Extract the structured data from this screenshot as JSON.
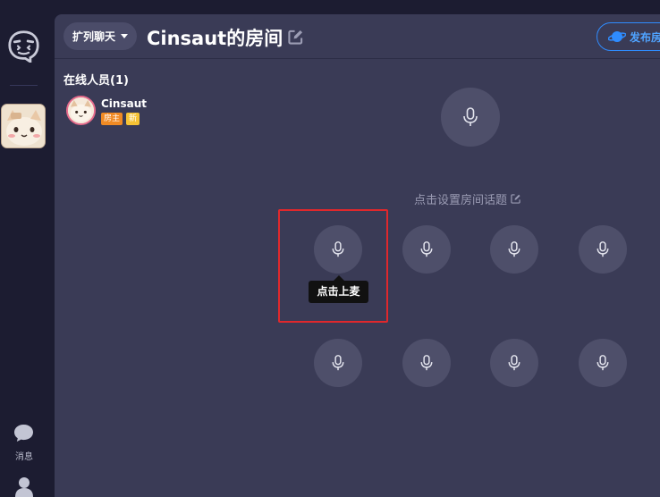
{
  "sidebar": {
    "messages_label": "消息"
  },
  "header": {
    "category_label": "扩列聊天",
    "room_title": "Cinsaut的房间",
    "publish_label": "发布房"
  },
  "online": {
    "title": "在线人员(1)",
    "members": [
      {
        "name": "Cinsaut",
        "badge_owner": "房主",
        "badge_new": "新"
      }
    ]
  },
  "room": {
    "topic_text": "点击设置房间话题",
    "tooltip_text": "点击上麦"
  },
  "icons": {
    "logo": "logo-face-icon",
    "seat": "microphone-icon",
    "message": "chat-bubble-icon",
    "user": "user-icon",
    "edit": "edit-icon",
    "publish": "planet-icon"
  },
  "colors": {
    "sidebar_bg": "#1c1c31",
    "panel_bg": "#3a3b56",
    "seat_bg": "#4e4f6a",
    "accent_blue": "#2f8cff",
    "owner_badge": "#f08a24",
    "new_badge": "#f6c335",
    "highlight_red": "#e0282c"
  }
}
